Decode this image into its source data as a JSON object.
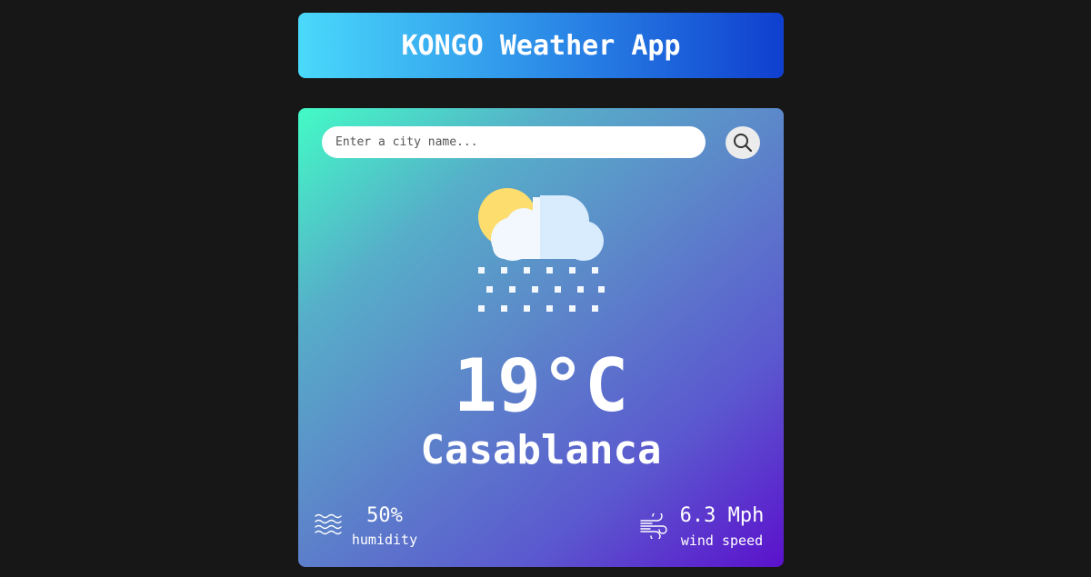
{
  "header": {
    "title": "KONGO Weather App"
  },
  "search": {
    "placeholder": "Enter a city name...",
    "value": "",
    "button_icon": "search-icon"
  },
  "weather": {
    "icon": "cloud-sun-snow-icon",
    "temperature": "19°C",
    "city": "Casablanca"
  },
  "details": {
    "humidity": {
      "icon": "humidity-waves-icon",
      "value": "50%",
      "label": "humidity"
    },
    "wind": {
      "icon": "wind-icon",
      "value": "6.3 Mph",
      "label": "wind speed"
    }
  },
  "colors": {
    "background": "#171717",
    "header_gradient": [
      "#4ad9fb",
      "#0f3fcf"
    ],
    "card_gradient": [
      "#43fbc6",
      "#5b11cc"
    ]
  }
}
